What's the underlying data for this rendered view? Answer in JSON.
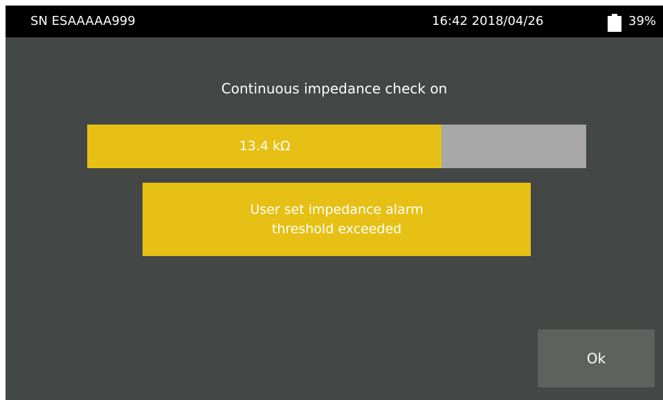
{
  "status_bar": {
    "serial": "SN ESAAAAA999",
    "datetime": "16:42 2018/04/26",
    "battery_icon": "battery-icon",
    "battery_level": "39%"
  },
  "main": {
    "title": "Continuous impedance check on",
    "impedance": {
      "value_label": "13.4 kΩ",
      "fill_fraction": 0.71,
      "fill_color": "#e6c015",
      "track_color": "#a8a8a8"
    },
    "alarm": {
      "line1": "User set impedance alarm",
      "line2": "threshold exceeded",
      "color": "#e6c015"
    }
  },
  "buttons": {
    "ok_label": "Ok"
  },
  "colors": {
    "background": "#434745",
    "status_bar": "#000000",
    "button": "#5d625f",
    "text": "#ffffff"
  }
}
